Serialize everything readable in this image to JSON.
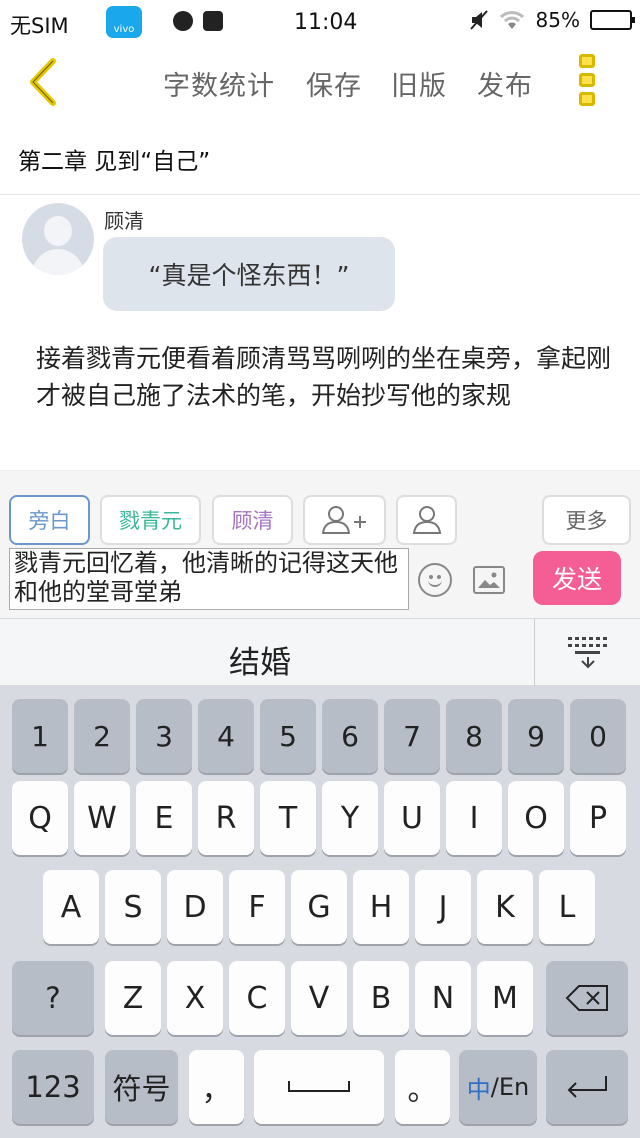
{
  "status_bar": {
    "carrier": "无SIM",
    "app_icon_label": "vivo",
    "time": "11:04",
    "battery": "85%",
    "battery_level": 0.85,
    "icons": [
      "vivo-store-icon",
      "globe-icon",
      "browser-icon",
      "mute-icon",
      "wifi-icon",
      "battery-icon"
    ]
  },
  "nav": {
    "back_icon": "chevron-left-icon",
    "word_count": "字数统计",
    "save": "保存",
    "old_version": "旧版",
    "publish": "发布",
    "more_icon": "more-menu-icon"
  },
  "chapter": {
    "title": "第二章  见到“自己”"
  },
  "dialog": {
    "speaker": "顾清",
    "line": "“真是个怪东西！”",
    "avatar_icon": "default-avatar-icon"
  },
  "narration": "接着戮青元便看着顾清骂骂咧咧的坐在桌旁，拿起刚才被自己施了法术的笔，开始抄写他的家规",
  "toolbar": {
    "roles": [
      "旁白",
      "戮青元",
      "顾清"
    ],
    "more": "更多",
    "add_role_icon": "add-person-icon",
    "person_icon": "person-icon"
  },
  "composer": {
    "input_value": "戮青元回忆着，他清晰的记得这天他和他的堂哥堂弟",
    "emoji_icon": "emoji-icon",
    "image_icon": "image-icon",
    "send": "发送"
  },
  "keyboard": {
    "suggestion": "结婚",
    "collapse_icon": "keyboard-collapse-icon",
    "row1": [
      "1",
      "2",
      "3",
      "4",
      "5",
      "6",
      "7",
      "8",
      "9",
      "0"
    ],
    "row2": [
      "Q",
      "W",
      "E",
      "R",
      "T",
      "Y",
      "U",
      "I",
      "O",
      "P"
    ],
    "row3": [
      "A",
      "S",
      "D",
      "F",
      "G",
      "H",
      "J",
      "K",
      "L"
    ],
    "row4_left": "?",
    "row4": [
      "Z",
      "X",
      "C",
      "V",
      "B",
      "N",
      "M"
    ],
    "backspace_icon": "backspace-icon",
    "key_123": "123",
    "key_symbols": "符号",
    "key_comma": "，",
    "key_period": "。",
    "lang_cn": "中",
    "lang_en": "/En",
    "enter_icon": "enter-icon"
  },
  "colors": {
    "back_arrow": "#e6c600",
    "narrator": "#6a98c9",
    "char1": "#39b79a",
    "char2": "#a673c2",
    "send": "#f45e95",
    "bubble": "#dde4ec"
  }
}
